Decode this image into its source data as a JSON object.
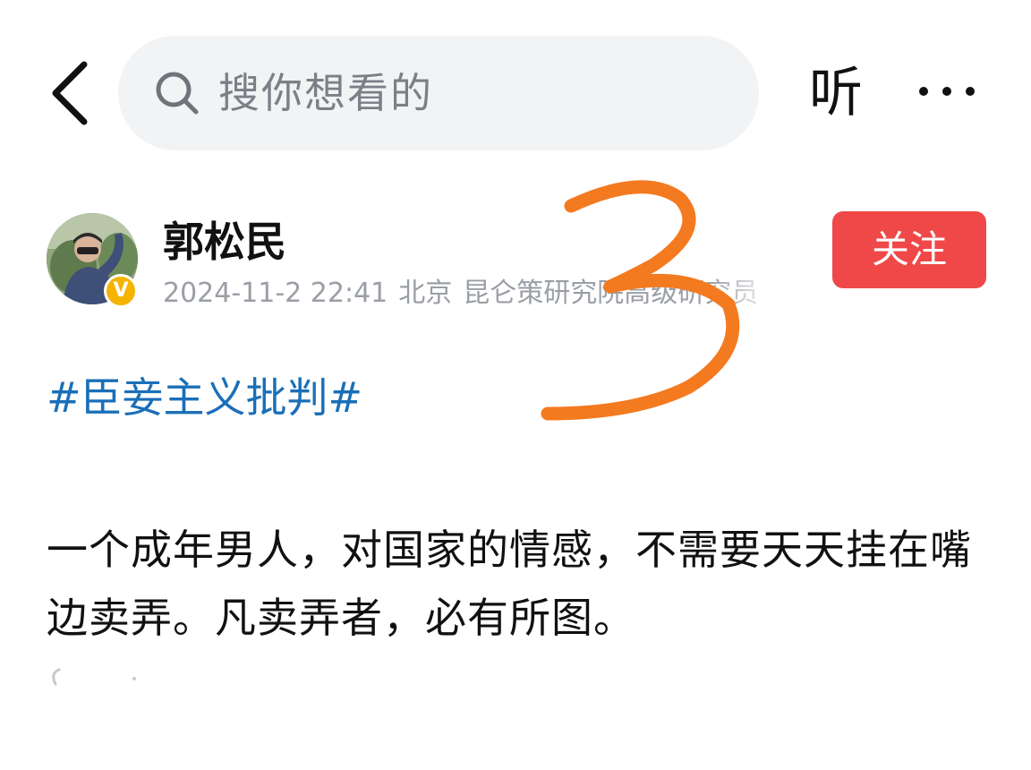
{
  "header": {
    "search_placeholder": "搜你想看的",
    "listen_label": "听"
  },
  "author": {
    "name": "郭松民",
    "meta": {
      "date": "2024-11-2 22:41",
      "location": "北京",
      "title": "昆仑策研究院高级研究员"
    },
    "follow_label": "关注",
    "vip_badge": "V"
  },
  "post": {
    "hashtag": "#臣妾主义批判#",
    "text": "一个成年男人，对国家的情感，不需要天天挂在嘴边卖弄。凡卖弄者，必有所图。"
  },
  "annotation": {
    "text": "3",
    "color": "#f47a20"
  },
  "colors": {
    "accent_red": "#f04848",
    "link_blue": "#1a6fb8",
    "search_bg": "#f2f3f5",
    "meta_gray": "#9a9ea5"
  },
  "icons": {
    "back": "chevron-left-icon",
    "search": "search-icon",
    "more": "more-dots-icon",
    "badge": "vip-badge-icon"
  }
}
